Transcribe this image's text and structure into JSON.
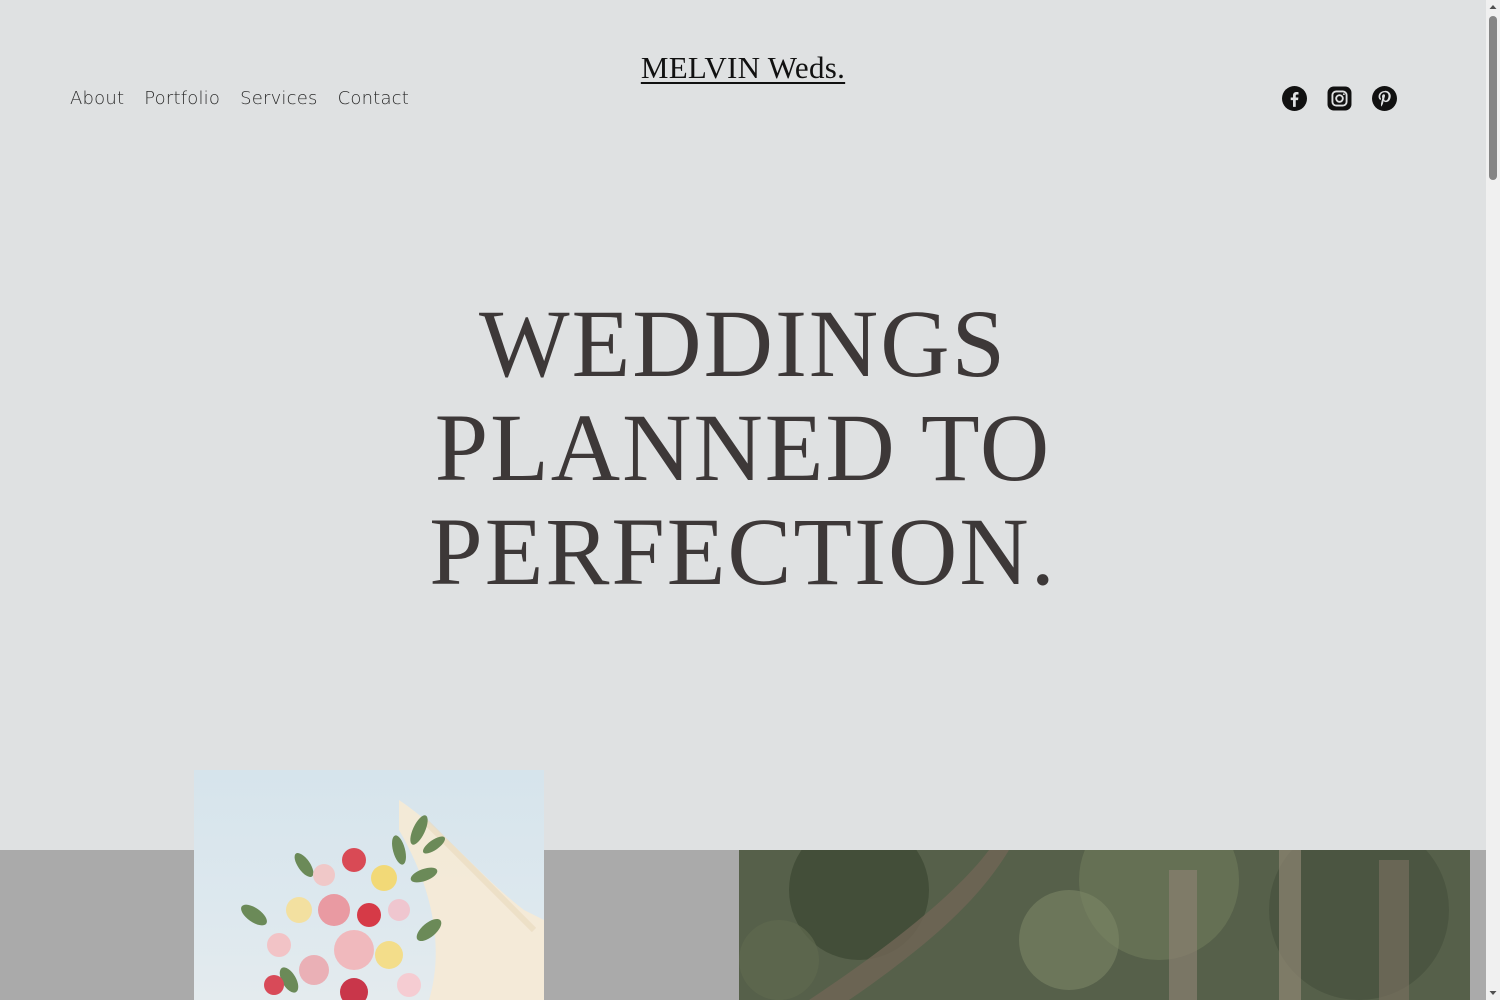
{
  "header": {
    "logo": "MELVIN Weds.",
    "nav": [
      "About",
      "Portfolio",
      "Services",
      "Contact"
    ],
    "social_icons": [
      "facebook-icon",
      "instagram-icon",
      "pinterest-icon"
    ]
  },
  "hero": {
    "lines": [
      "WEDDINGS",
      "PLANNED TO",
      "PERFECTION."
    ]
  },
  "gallery": {
    "images": [
      "flower-bouquet-photo",
      "forest-photo"
    ]
  },
  "colors": {
    "background": "#dfe1e2",
    "band": "#aaaaaa",
    "heading": "#3d3838",
    "text": "#2b2b2b"
  }
}
